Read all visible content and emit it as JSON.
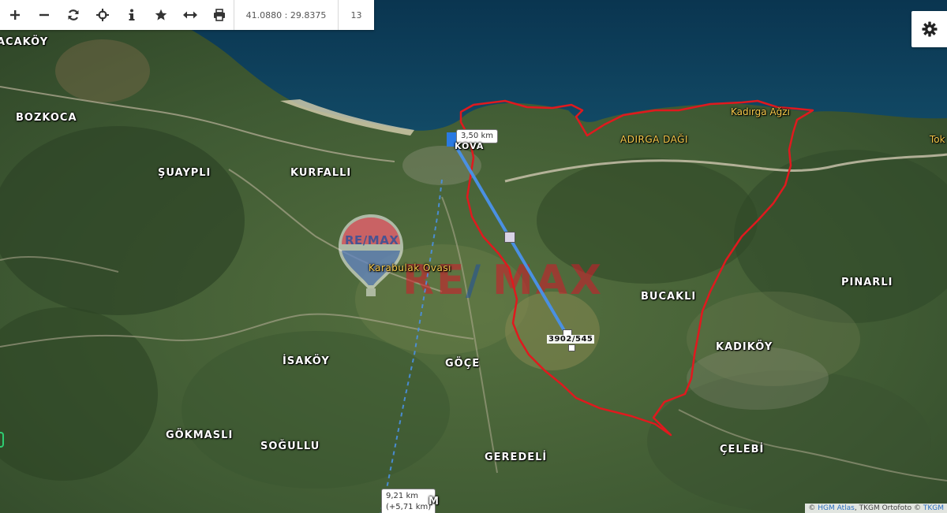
{
  "toolbar": {
    "buttons": [
      {
        "name": "zoom-in-button",
        "icon": "plus-icon",
        "glyph": "+"
      },
      {
        "name": "zoom-out-button",
        "icon": "minus-icon",
        "glyph": "−"
      },
      {
        "name": "refresh-button",
        "icon": "refresh-icon",
        "glyph": "↻"
      },
      {
        "name": "locate-button",
        "icon": "crosshair-icon",
        "glyph": "⌖"
      },
      {
        "name": "info-button",
        "icon": "info-icon",
        "glyph": "i"
      },
      {
        "name": "favorite-button",
        "icon": "star-icon",
        "glyph": "★"
      },
      {
        "name": "measure-button",
        "icon": "measure-icon",
        "glyph": "↔"
      },
      {
        "name": "print-button",
        "icon": "printer-icon",
        "glyph": "⎙"
      }
    ],
    "coordinates": "41.0880 : 29.8375",
    "zoom_level": "13"
  },
  "settings": {
    "icon": "gear-icon"
  },
  "places": [
    {
      "key": "acakoy",
      "label": "ACAKÖY",
      "type": "village"
    },
    {
      "key": "bozkoca",
      "label": "BOZKOCA",
      "type": "village"
    },
    {
      "key": "suaypli",
      "label": "ŞUAYPLI",
      "type": "village"
    },
    {
      "key": "kurfalli",
      "label": "KURFALLI",
      "type": "village"
    },
    {
      "key": "kova",
      "label": "KOVA",
      "type": "village"
    },
    {
      "key": "karabulak",
      "label": "Karabulak Ovası",
      "type": "minor"
    },
    {
      "key": "kirga",
      "label": "ADIRGA DAĞI",
      "type": "minor"
    },
    {
      "key": "kadirga-agzi",
      "label": "Kadırga Ağzı",
      "type": "water"
    },
    {
      "key": "tok",
      "label": "Tok",
      "type": "water"
    },
    {
      "key": "bucakli",
      "label": "BUCAKLI",
      "type": "village"
    },
    {
      "key": "pinarli",
      "label": "PINARLI",
      "type": "village"
    },
    {
      "key": "kadikoy",
      "label": "KADIKÖY",
      "type": "village"
    },
    {
      "key": "isakoy",
      "label": "İSAKÖY",
      "type": "village"
    },
    {
      "key": "goce",
      "label": "GÖÇE",
      "type": "village"
    },
    {
      "key": "gokmasli",
      "label": "GÖKMASLI",
      "type": "village"
    },
    {
      "key": "sogullu",
      "label": "SOĞULLU",
      "type": "village"
    },
    {
      "key": "geredeli",
      "label": "GEREDELİ",
      "type": "village"
    },
    {
      "key": "celebi",
      "label": "ÇELEBİ",
      "type": "village"
    },
    {
      "key": "m",
      "label": "M",
      "type": "village"
    }
  ],
  "measurement": {
    "distance_label": "3,50 km",
    "route_label_line1": "9,21 km",
    "route_label_line2": "(+5,71 km)"
  },
  "parcel": {
    "label": "3902/545",
    "outline_color": "#e0191e"
  },
  "watermark": {
    "logo_text": "RE/MAX",
    "text_re": "RE",
    "text_max": "MAX"
  },
  "attribution": {
    "prefix": "© ",
    "link1": "HGM Atlas",
    "middle": ", TKGM Ortofoto © ",
    "link2": "TKGM"
  },
  "colors": {
    "sea": "#0d3d5c",
    "measure_line": "#4a90e2",
    "boundary": "#e0191e"
  }
}
